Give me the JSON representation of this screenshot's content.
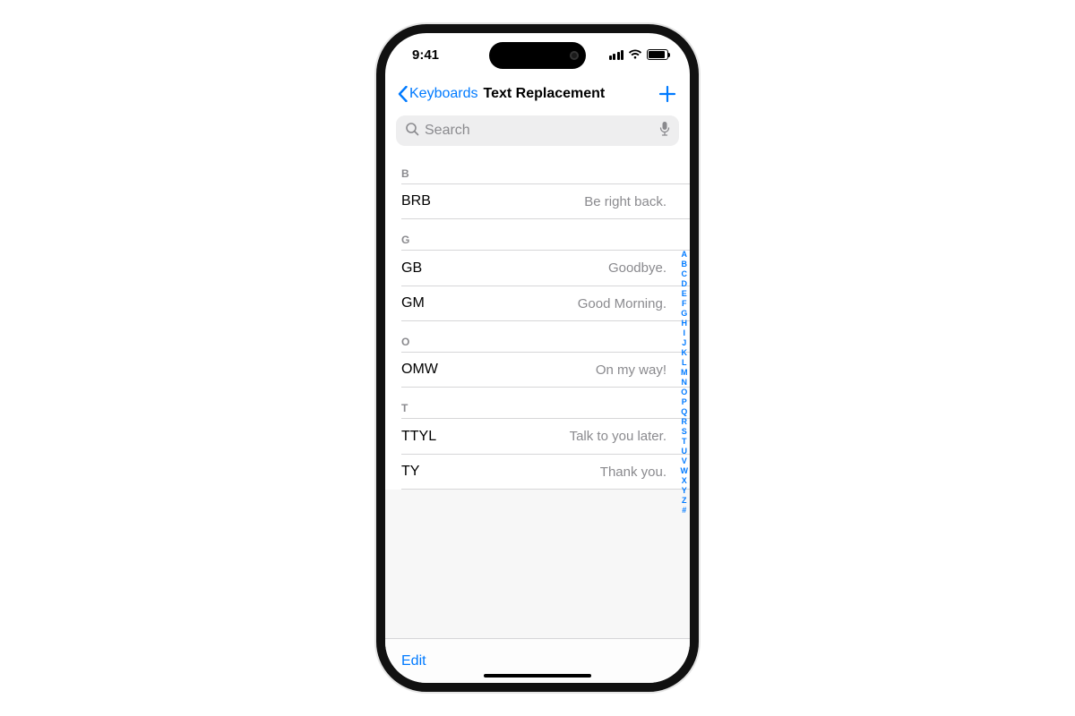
{
  "status": {
    "time": "9:41"
  },
  "nav": {
    "back_label": "Keyboards",
    "title": "Text Replacement"
  },
  "search": {
    "placeholder": "Search"
  },
  "sections": [
    {
      "letter": "B",
      "rows": [
        {
          "short": "BRB",
          "phrase": "Be right back."
        }
      ]
    },
    {
      "letter": "G",
      "rows": [
        {
          "short": "GB",
          "phrase": "Goodbye."
        },
        {
          "short": "GM",
          "phrase": "Good Morning."
        }
      ]
    },
    {
      "letter": "O",
      "rows": [
        {
          "short": "OMW",
          "phrase": "On my way!"
        }
      ]
    },
    {
      "letter": "T",
      "rows": [
        {
          "short": "TTYL",
          "phrase": "Talk to you later."
        },
        {
          "short": "TY",
          "phrase": "Thank you."
        }
      ]
    }
  ],
  "index": [
    "A",
    "B",
    "C",
    "D",
    "E",
    "F",
    "G",
    "H",
    "I",
    "J",
    "K",
    "L",
    "M",
    "N",
    "O",
    "P",
    "Q",
    "R",
    "S",
    "T",
    "U",
    "V",
    "W",
    "X",
    "Y",
    "Z",
    "#"
  ],
  "toolbar": {
    "edit_label": "Edit"
  }
}
